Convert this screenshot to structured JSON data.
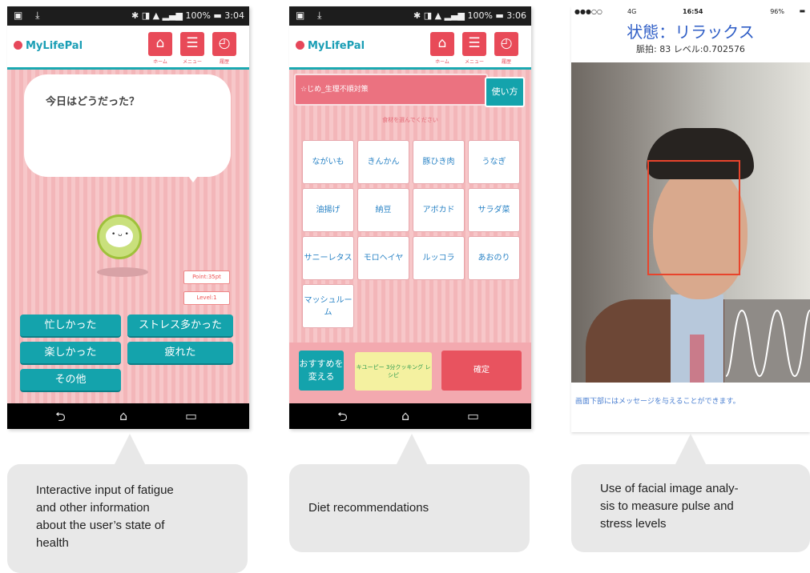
{
  "phone1": {
    "status_time": "3:04",
    "status_battery": "100%",
    "app_name": "MyLifePal",
    "nav": [
      "ホーム",
      "メニュー",
      "履歴"
    ],
    "prompt": "今日はどうだった？",
    "points_badge": "Point:35pt",
    "level_badge": "Level:1",
    "buttons": [
      "忙しかった",
      "ストレス多かった",
      "楽しかった",
      "疲れた",
      "その他"
    ]
  },
  "phone2": {
    "status_time": "3:06",
    "status_battery": "100%",
    "app_name": "MyLifePal",
    "nav": [
      "ホーム",
      "メニュー",
      "履歴"
    ],
    "topic": "☆じめ_生理不順対策",
    "howto_button": "使い方",
    "hint": "食材を選んでください",
    "foods": [
      "ながいも",
      "きんかん",
      "豚ひき肉",
      "うなぎ",
      "油揚げ",
      "納豆",
      "アボカド",
      "サラダ菜",
      "サニーレタス",
      "モロヘイヤ",
      "ルッコラ",
      "あおのり",
      "マッシュルーム"
    ],
    "recommend_button": "おすすめを変える",
    "kewpie_label": "キユーピー 3分クッキング レシピ",
    "confirm_button": "確定"
  },
  "ios": {
    "status_carrier": "4G",
    "status_time": "16:54",
    "status_battery": "96%",
    "state_title": "状態：リラックス",
    "pulse_text": "脈拍: 83 レベル:0.702576",
    "caption": "画面下部にはメッセージを与えることができます。"
  },
  "callouts": {
    "c1": [
      "Interactive input of fatigue",
      "and other information",
      "about the user’s state of",
      "health"
    ],
    "c2": [
      "Diet recommendations"
    ],
    "c3": [
      "Use of facial image analy-",
      "sis to measure pulse and",
      "stress levels"
    ]
  },
  "colors": {
    "teal": "#14a3ac",
    "pink": "#f6c3c5",
    "red": "#e84a58",
    "ios_blue": "#2f5ec6"
  }
}
